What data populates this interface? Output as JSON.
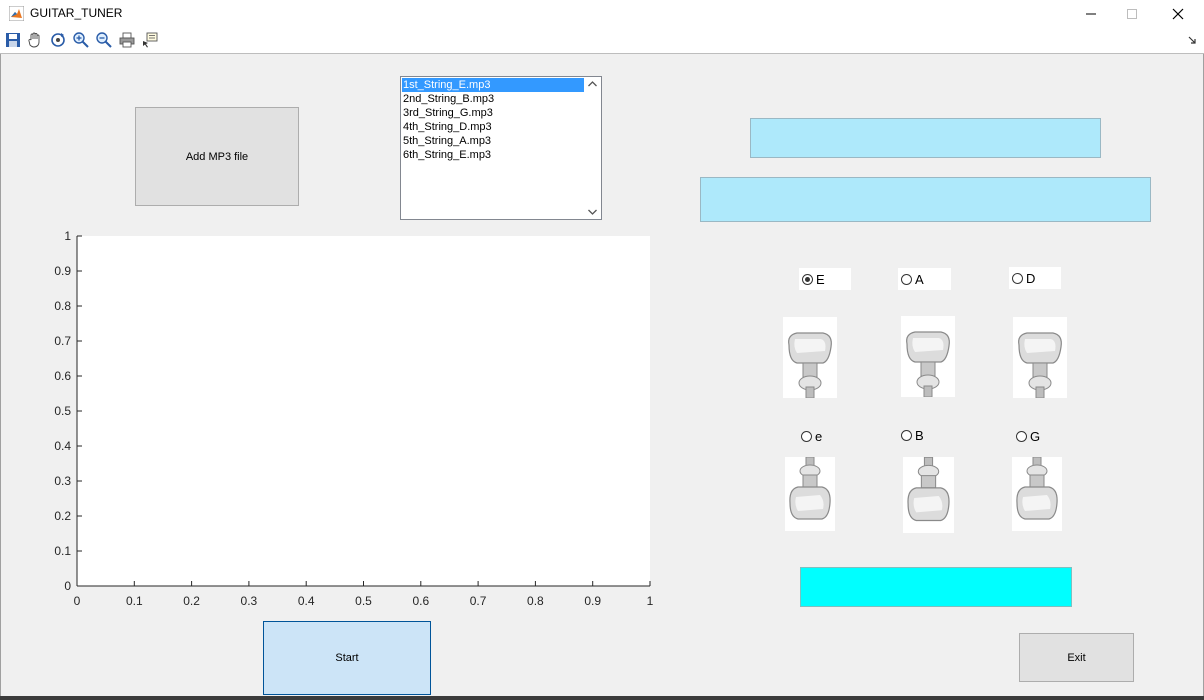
{
  "window": {
    "title": "GUITAR_TUNER",
    "minimize_icon": "minimize-icon",
    "maximize_icon": "maximize-icon",
    "close_icon": "close-icon"
  },
  "toolbar": {
    "icons": [
      "save-icon",
      "pan-hand-icon",
      "rotate-3d-icon",
      "zoom-in-icon",
      "zoom-out-icon",
      "print-icon",
      "data-cursor-icon"
    ],
    "dock_icon": "dock-arrow-icon"
  },
  "buttons": {
    "add_mp3": "Add MP3 file",
    "start": "Start",
    "exit": "Exit"
  },
  "file_list": {
    "items": [
      "1st_String_E.mp3",
      "2nd_String_B.mp3",
      "3rd_String_G.mp3",
      "4th_String_D.mp3",
      "5th_String_A.mp3",
      "6th_String_E.mp3"
    ],
    "selected_index": 0
  },
  "fields": {
    "top_value": "",
    "middle_value": "",
    "bottom_value": ""
  },
  "colors": {
    "field_light_cyan": "#aee9fb",
    "field_cyan": "#00ffff",
    "start_button": "#cce4f7",
    "selection": "#3399ff"
  },
  "strings": [
    {
      "label": "E",
      "selected": true
    },
    {
      "label": "A",
      "selected": false
    },
    {
      "label": "D",
      "selected": false
    },
    {
      "label": "e",
      "selected": false
    },
    {
      "label": "B",
      "selected": false
    },
    {
      "label": "G",
      "selected": false
    }
  ],
  "chart_data": {
    "type": "line",
    "series": [],
    "xlim": [
      0,
      1
    ],
    "ylim": [
      0,
      1
    ],
    "xticks": [
      "0",
      "0.1",
      "0.2",
      "0.3",
      "0.4",
      "0.5",
      "0.6",
      "0.7",
      "0.8",
      "0.9",
      "1"
    ],
    "yticks": [
      "0",
      "0.1",
      "0.2",
      "0.3",
      "0.4",
      "0.5",
      "0.6",
      "0.7",
      "0.8",
      "0.9",
      "1"
    ],
    "grid": false,
    "title": "",
    "xlabel": "",
    "ylabel": ""
  }
}
